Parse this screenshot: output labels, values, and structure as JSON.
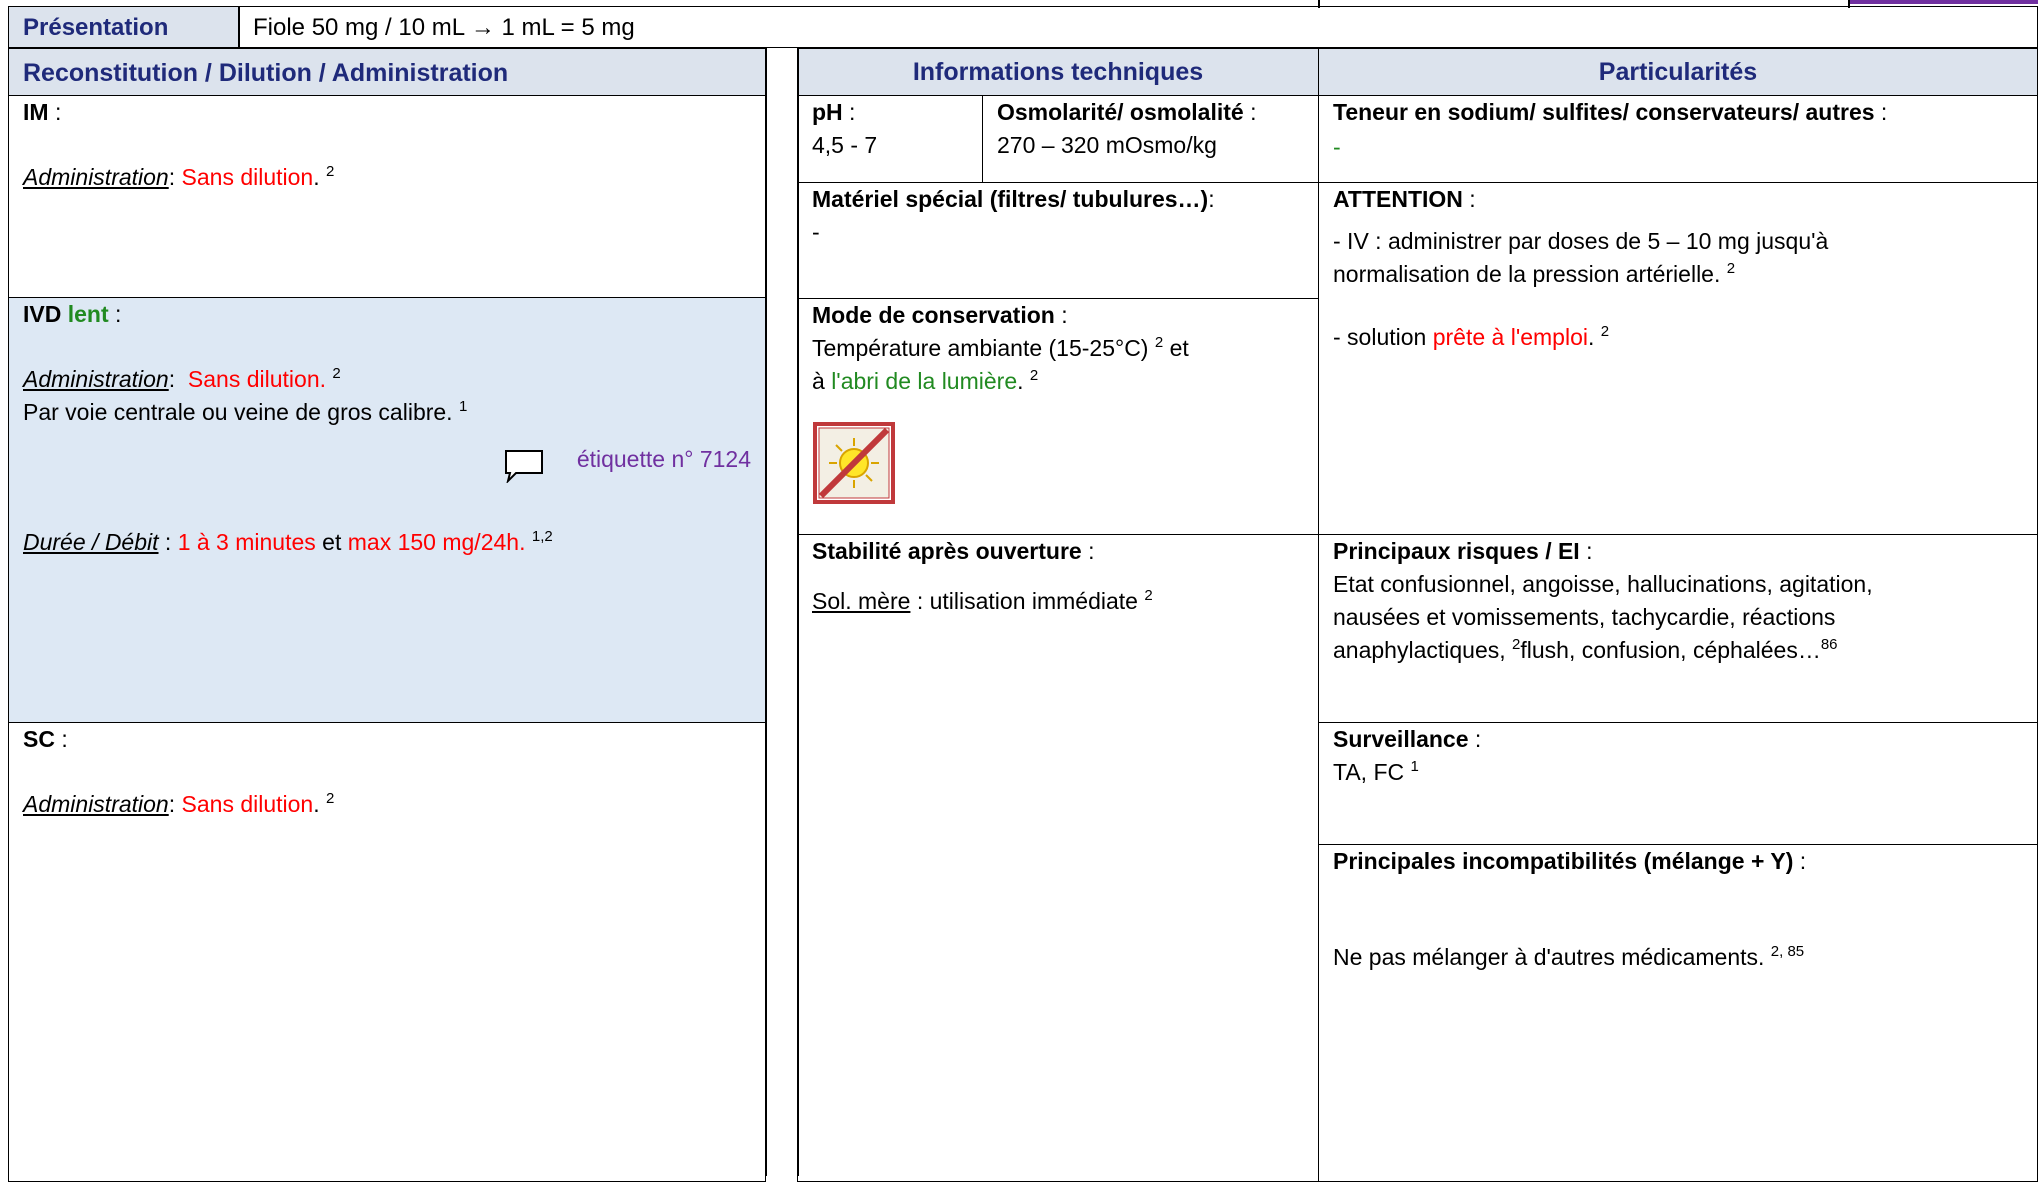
{
  "presentation": {
    "label": "Présentation",
    "value": "Fiole 50 mg / 10 mL → 1 mL = 5 mg"
  },
  "headers": {
    "recon": "Reconstitution / Dilution / Administration",
    "tech": "Informations techniques",
    "part": "Particularités"
  },
  "im": {
    "title": "IM",
    "colon": " :",
    "admin_label": "Administration",
    "admin_sep": ": ",
    "admin_value": "Sans dilution",
    "ref": "2"
  },
  "ivd": {
    "title": "IVD",
    "lent": "lent",
    "colon": " :",
    "admin_label": "Administration",
    "admin_sep": ":  ",
    "admin_value": "Sans dilution.",
    "admin_ref": "2",
    "route": "Par voie centrale ou veine de gros calibre.",
    "route_ref": "1",
    "etiquette": "étiquette n° 7124",
    "duree_label": "Durée / Débit",
    "duree_sep": " : ",
    "duree_value1": "1 à 3 minutes",
    "duree_et": " et ",
    "duree_value2": "max 150 mg/24h.",
    "duree_ref": "1,2"
  },
  "sc": {
    "title": "SC",
    "colon": " :",
    "admin_label": "Administration",
    "admin_sep": ": ",
    "admin_value": "Sans dilution",
    "ref": "2"
  },
  "ph": {
    "label": "pH",
    "colon": " :",
    "value": "4,5 - 7"
  },
  "osmo": {
    "label": "Osmolarité/ osmolalité",
    "colon": " :",
    "value": "270 – 320 mOsmo/kg"
  },
  "materiel": {
    "label": "Matériel spécial (filtres/ tubulures…)",
    "colon": ":",
    "value": "-"
  },
  "conservation": {
    "label": "Mode de conservation",
    "colon": " :",
    "line1": "Température ambiante (15-25°C)",
    "ref1": "2",
    "et": " et",
    "a": "à ",
    "lumiere": "l'abri de la lumière",
    "ref2": "2",
    "icon": "no-sunlight-icon"
  },
  "stabilite": {
    "label": "Stabilité après ouverture",
    "colon": " :",
    "sol_label": "Sol. mère",
    "sol_value": " : utilisation immédiate",
    "ref": "2"
  },
  "teneur": {
    "label": "Teneur en sodium/ sulfites/ conservateurs/ autres",
    "colon": " :",
    "value": "-"
  },
  "attention": {
    "label": "ATTENTION",
    "colon": " :",
    "line1": "- IV : administrer par doses de 5 – 10 mg jusqu'à",
    "line2": "normalisation de la pression artérielle.",
    "ref1": "2",
    "line3_pre": "- solution ",
    "line3_red": "prête à l'emploi",
    "ref2": "2"
  },
  "risques": {
    "label": "Principaux risques / EI",
    "colon": " :",
    "line1": "Etat confusionnel, angoisse, hallucinations, agitation,",
    "line2": "nausées et vomissements, tachycardie, réactions",
    "line3a": "anaphylactiques,",
    "ref1": "2",
    "line3b": "flush, confusion, céphalées…",
    "ref2": "86"
  },
  "surveillance": {
    "label": "Surveillance",
    "colon": " :",
    "value": "TA, FC",
    "ref": "1"
  },
  "incompat": {
    "label": "Principales incompatibilités (mélange + Y)",
    "colon": " :",
    "value": "Ne pas mélanger à d'autres médicaments.",
    "ref": "2, 85"
  },
  "colors": {
    "navy": "#1f2a7a",
    "red": "#ff0000",
    "green": "#218a21",
    "purple": "#7030a0",
    "ivd_bg": "#dde8f4"
  }
}
